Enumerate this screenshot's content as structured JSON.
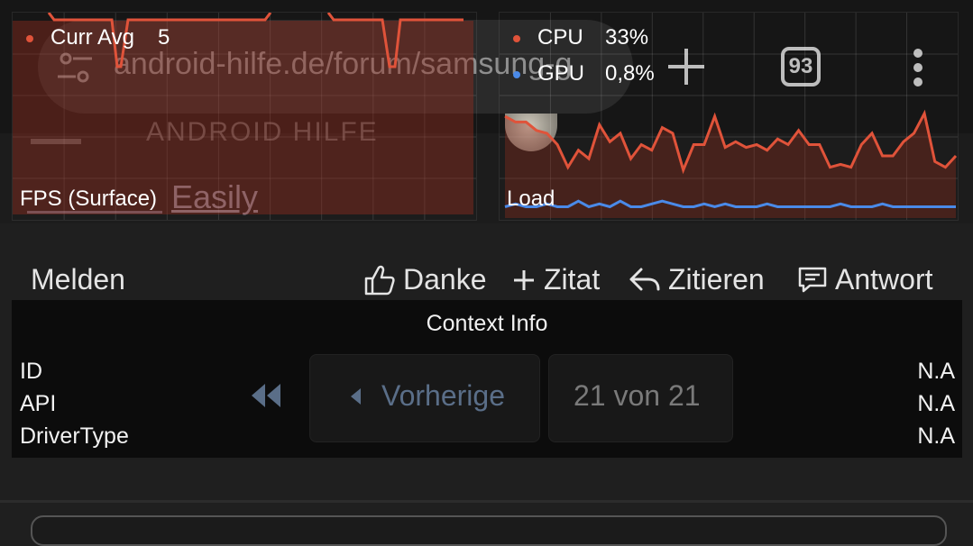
{
  "browser": {
    "url": "android-hilfe.de/forum/samsung-g",
    "tab_count": "93"
  },
  "forum": {
    "logo": "ANDROID HILFE",
    "bg_word": "Easily"
  },
  "overlay": {
    "fps": {
      "label": "FPS (Surface)",
      "legend": "Curr Avg",
      "value": "5",
      "color": "#e0533a"
    },
    "load": {
      "label": "Load",
      "cpu_label": "CPU",
      "cpu_value": "33%",
      "gpu_label": "GPU",
      "gpu_value": "0,8%",
      "cpu_color": "#e0533a",
      "gpu_color": "#4a8ae8"
    }
  },
  "actions": {
    "report": "Melden",
    "thanks": "Danke",
    "quote_add": "Zitat",
    "quote": "Zitieren",
    "reply": "Antwort"
  },
  "context": {
    "title": "Context Info",
    "rows": [
      {
        "label": "ID",
        "value": "N.A"
      },
      {
        "label": "API",
        "value": "N.A"
      },
      {
        "label": "DriverType",
        "value": "N.A"
      }
    ]
  },
  "pagination": {
    "prev": "Vorherige",
    "page": "21 von 21"
  },
  "chart_data": [
    {
      "type": "line",
      "title": "FPS (Surface)",
      "series": [
        {
          "name": "Curr Avg"
        }
      ]
    },
    {
      "type": "area",
      "title": "Load",
      "series": [
        {
          "name": "CPU",
          "values": [
            36,
            34,
            34,
            31,
            30,
            26,
            18,
            24,
            21,
            33,
            27,
            30,
            21,
            26,
            24,
            32,
            30,
            17,
            26,
            26,
            36,
            25,
            27,
            25,
            26,
            24,
            28,
            26,
            31,
            26,
            26,
            18,
            19,
            18,
            26,
            30,
            22,
            22,
            27,
            30,
            37,
            20,
            18,
            22
          ]
        },
        {
          "name": "GPU",
          "values": [
            4,
            5,
            4,
            4,
            5,
            4,
            4,
            6,
            4,
            5,
            4,
            6,
            4,
            4,
            5,
            6,
            5,
            4,
            4,
            5,
            4,
            5,
            4,
            4,
            4,
            5,
            4,
            4,
            4,
            4,
            4,
            4,
            5,
            4,
            4,
            4,
            5,
            4,
            4,
            4,
            4,
            4,
            4,
            4
          ]
        }
      ],
      "ylim": [
        0,
        50
      ]
    }
  ]
}
